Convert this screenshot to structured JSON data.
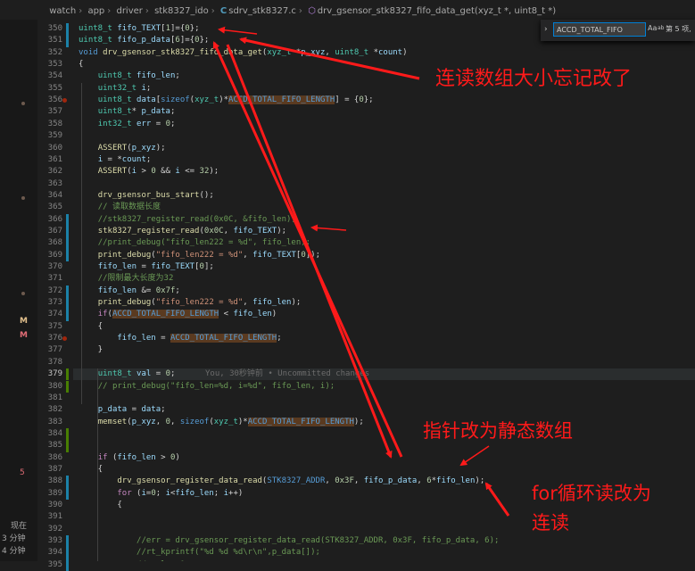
{
  "breadcrumb": {
    "items": [
      "watch",
      "app",
      "driver",
      "stk8327_ido",
      "sdrv_stk8327.c",
      "drv_gsensor_stk8327_fifo_data_get(xyz_t *, uint8_t *)"
    ]
  },
  "find_widget": {
    "query": "ACCD_TOTAL_FIFO",
    "opt_case": "Aa",
    "opt_word": "ab",
    "result": "第 5 项,"
  },
  "activity": {
    "marks": [
      "M",
      "M",
      "5"
    ],
    "timeline_label": "现在",
    "timeline_items": [
      "3 分钟",
      "4 分钟"
    ]
  },
  "editor": {
    "lines": [
      {
        "n": "350",
        "code": "uint8_t fifo_TEXT[1]={0};"
      },
      {
        "n": "351",
        "code": "uint8_t fifo_p_data[6]={0};"
      },
      {
        "n": "352",
        "code": "void drv_gsensor_stk8327_fifo_data_get(xyz_t *p_xyz, uint8_t *count)"
      },
      {
        "n": "353",
        "code": "{"
      },
      {
        "n": "354",
        "code": "    uint8_t fifo_len;"
      },
      {
        "n": "355",
        "code": "    uint32_t i;"
      },
      {
        "n": "356",
        "code": "    uint8_t data[sizeof(xyz_t)*ACCD_TOTAL_FIFO_LENGTH] = {0};"
      },
      {
        "n": "357",
        "code": "    uint8_t* p_data;"
      },
      {
        "n": "358",
        "code": "    int32_t err = 0;"
      },
      {
        "n": "359",
        "code": ""
      },
      {
        "n": "360",
        "code": "    ASSERT(p_xyz);"
      },
      {
        "n": "361",
        "code": "    i = *count;"
      },
      {
        "n": "362",
        "code": "    ASSERT(i > 0 && i <= 32);"
      },
      {
        "n": "363",
        "code": ""
      },
      {
        "n": "364",
        "code": "    drv_gsensor_bus_start();"
      },
      {
        "n": "365",
        "code": "    // 读取数据长度"
      },
      {
        "n": "366",
        "code": "    //stk8327_register_read(0x0C, &fifo_len);"
      },
      {
        "n": "367",
        "code": "    stk8327_register_read(0x0C, fifo_TEXT);"
      },
      {
        "n": "368",
        "code": "    //print_debug(\"fifo_len222 = %d\", fifo_len);"
      },
      {
        "n": "369",
        "code": "    print_debug(\"fifo_len222 = %d\", fifo_TEXT[0]);"
      },
      {
        "n": "370",
        "code": "    fifo_len = fifo_TEXT[0];"
      },
      {
        "n": "371",
        "code": "    //限制最大长度为32"
      },
      {
        "n": "372",
        "code": "    fifo_len &= 0x7f;"
      },
      {
        "n": "373",
        "code": "    print_debug(\"fifo_len222 = %d\", fifo_len);"
      },
      {
        "n": "374",
        "code": "    if(ACCD_TOTAL_FIFO_LENGTH < fifo_len)"
      },
      {
        "n": "375",
        "code": "    {"
      },
      {
        "n": "376",
        "code": "        fifo_len = ACCD_TOTAL_FIFO_LENGTH;"
      },
      {
        "n": "377",
        "code": "    }"
      },
      {
        "n": "378",
        "code": ""
      },
      {
        "n": "379",
        "code": "    uint8_t val = 0;"
      },
      {
        "n": "380",
        "code": "    // print_debug(\"fifo_len=%d, i=%d\", fifo_len, i);"
      },
      {
        "n": "381",
        "code": ""
      },
      {
        "n": "382",
        "code": "    p_data = data;"
      },
      {
        "n": "383",
        "code": "    memset(p_xyz, 0, sizeof(xyz_t)*ACCD_TOTAL_FIFO_LENGTH);"
      },
      {
        "n": "384",
        "code": ""
      },
      {
        "n": "385",
        "code": ""
      },
      {
        "n": "386",
        "code": "    if (fifo_len > 0)"
      },
      {
        "n": "387",
        "code": "    {"
      },
      {
        "n": "388",
        "code": "        drv_gsensor_register_data_read(STK8327_ADDR, 0x3F, fifo_p_data, 6*fifo_len);"
      },
      {
        "n": "389",
        "code": "        for (i=0; i<fifo_len; i++)"
      },
      {
        "n": "390",
        "code": "        {"
      },
      {
        "n": "391",
        "code": ""
      },
      {
        "n": "392",
        "code": ""
      },
      {
        "n": "393",
        "code": "            //err = drv_gsensor_register_data_read(STK8327_ADDR, 0x3F, fifo_p_data, 6);"
      },
      {
        "n": "394",
        "code": "            //rt_kprintf(\"%d %d %d\\r\\n\",p_data[]);"
      },
      {
        "n": "395",
        "code": "            // val = 0;"
      }
    ],
    "blame_text": "You, 30秒钟前 • Uncommitted changes"
  },
  "annotations": {
    "a1": "连读数组大小忘记改了",
    "a2": "指针改为静态数组",
    "a3_line1": "for循环读改为",
    "a3_line2": "连读"
  },
  "colors": {
    "background": "#1e1e1e",
    "annotation": "#ff1a1a"
  }
}
